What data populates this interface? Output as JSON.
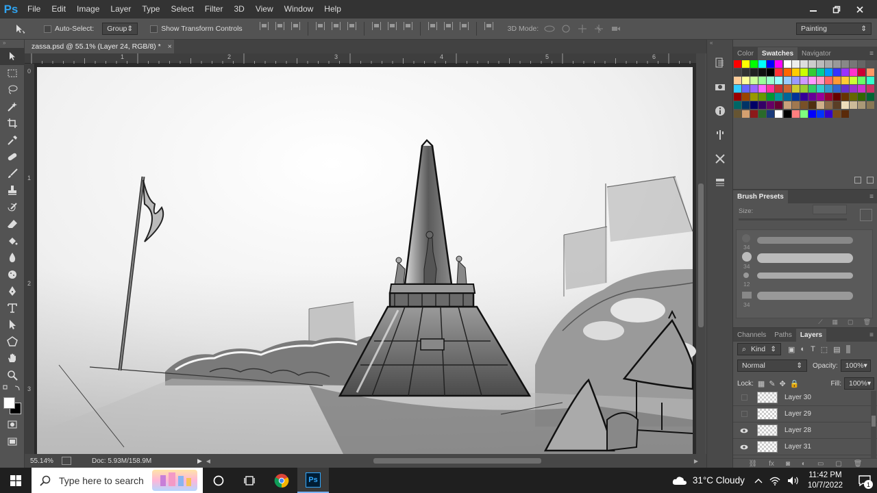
{
  "app": {
    "logo": "Ps"
  },
  "menubar": {
    "items": [
      "File",
      "Edit",
      "Image",
      "Layer",
      "Type",
      "Select",
      "Filter",
      "3D",
      "View",
      "Window",
      "Help"
    ],
    "window_controls": [
      "minimize",
      "restore",
      "close"
    ]
  },
  "options": {
    "auto_select_label": "Auto-Select:",
    "auto_select_value": "Group",
    "transform_label": "Show Transform Controls",
    "mode_3d_label": "3D Mode:",
    "workspace_value": "Painting"
  },
  "document": {
    "tab_title": "zassa.psd @ 55.1% (Layer 24, RGB/8) *",
    "tab_close": "×",
    "zoom": "55.14%",
    "doc_info": "Doc: 5.93M/158.9M",
    "ruler_top": [
      "1",
      "2",
      "3",
      "4",
      "5",
      "6"
    ],
    "ruler_left": [
      "0",
      "1",
      "2",
      "3"
    ]
  },
  "panels": {
    "top_tabs": [
      "Color",
      "Swatches",
      "Navigator"
    ],
    "active_top_tab": "Swatches",
    "swatch_colors": [
      "#ff0000",
      "#ffff00",
      "#00ff00",
      "#00ffff",
      "#0000ff",
      "#ff00ff",
      "#ffffff",
      "#eeeeee",
      "#dddddd",
      "#cccccc",
      "#bbbbbb",
      "#aaaaaa",
      "#999999",
      "#888888",
      "#777777",
      "#666666",
      "#555555",
      "#444444",
      "#333333",
      "#222222",
      "#111111",
      "#000000",
      "#ff3333",
      "#ff6600",
      "#ffcc00",
      "#ccff00",
      "#33cc33",
      "#00cc99",
      "#0099ff",
      "#3333ff",
      "#9933ff",
      "#ff33cc",
      "#cc0033",
      "#ff9966",
      "#ffcc99",
      "#ffff99",
      "#ccff99",
      "#99ff99",
      "#99ffcc",
      "#99ffff",
      "#99ccff",
      "#9999ff",
      "#cc99ff",
      "#ff99ff",
      "#ff99cc",
      "#ff6666",
      "#ff9933",
      "#ffcc33",
      "#ccff33",
      "#66ff66",
      "#33ffcc",
      "#33ccff",
      "#6666ff",
      "#9966ff",
      "#ff66ff",
      "#ff3399",
      "#cc3333",
      "#cc6633",
      "#cccc33",
      "#99cc33",
      "#33cc66",
      "#33cccc",
      "#3399cc",
      "#3366cc",
      "#6633cc",
      "#9933cc",
      "#cc33cc",
      "#cc3366",
      "#990000",
      "#994400",
      "#999900",
      "#669900",
      "#009933",
      "#009999",
      "#006699",
      "#003399",
      "#330099",
      "#660099",
      "#990099",
      "#990033",
      "#660000",
      "#663300",
      "#666600",
      "#336600",
      "#006633",
      "#006666",
      "#003366",
      "#000066",
      "#330066",
      "#660066",
      "#660033",
      "#c8a07a",
      "#a07850",
      "#785028",
      "#503010",
      "#cfb08a",
      "#8c6a48",
      "#5a3e26",
      "#eeddbb",
      "#ccbb99",
      "#aa9977",
      "#887755",
      "#665533",
      "#d4a070",
      "#8c1a1a",
      "#2a6a2a",
      "#1a3a7a",
      "#ffffff",
      "#000000",
      "#ff7f7f",
      "#7fff7f",
      "#0000ff",
      "#0033ff",
      "#3300cc",
      "#7a4a1a",
      "#5a2a0a"
    ],
    "brush_presets_title": "Brush Presets",
    "brush_size_label": "Size:",
    "brush_sizes": [
      "34",
      "34",
      "12",
      "34"
    ],
    "layer_tabs": [
      "Channels",
      "Paths",
      "Layers"
    ],
    "active_layer_tab": "Layers",
    "kind_value": "Kind",
    "blend_mode": "Normal",
    "opacity_label": "Opacity:",
    "opacity_value": "100%",
    "lock_label": "Lock:",
    "fill_label": "Fill:",
    "fill_value": "100%",
    "layers": [
      {
        "name": "Layer 30",
        "visible": false
      },
      {
        "name": "Layer 29",
        "visible": false
      },
      {
        "name": "Layer 28",
        "visible": true
      },
      {
        "name": "Layer 31",
        "visible": true
      }
    ]
  },
  "taskbar": {
    "search_placeholder": "Type here to search",
    "weather": "31°C  Cloudy",
    "time": "11:42 PM",
    "date": "10/7/2022",
    "notification_count": "1"
  }
}
